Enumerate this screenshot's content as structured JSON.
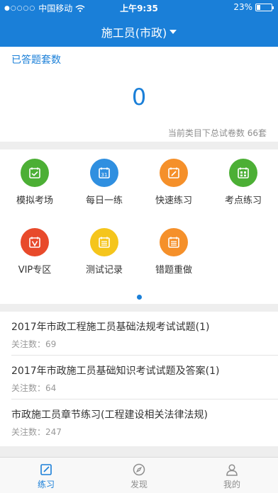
{
  "status_bar": {
    "carrier": "中国移动",
    "time": "上午9:35",
    "battery": "23%",
    "battery_level": 0.23
  },
  "nav": {
    "title": "施工员(市政)"
  },
  "stats": {
    "label": "已答题套数",
    "count": "0",
    "note": "当前类目下总试卷数 66套"
  },
  "grid": [
    {
      "label": "模拟考场",
      "color": "#4caf35",
      "icon": "exam-icon"
    },
    {
      "label": "每日一练",
      "color": "#2f8fe0",
      "icon": "calendar-icon"
    },
    {
      "label": "快速练习",
      "color": "#f5902a",
      "icon": "pencil-icon"
    },
    {
      "label": "考点练习",
      "color": "#4caf35",
      "icon": "grid-icon"
    },
    {
      "label": "VIP专区",
      "color": "#e84a2b",
      "icon": "vip-icon"
    },
    {
      "label": "测试记录",
      "color": "#f5c51c",
      "icon": "list-icon"
    },
    {
      "label": "错题重做",
      "color": "#f5902a",
      "icon": "list-icon"
    }
  ],
  "list": [
    {
      "title": "2017年市政工程施工员基础法规考试试题(1)",
      "meta": "关注数：69"
    },
    {
      "title": "2017年市政施工员基础知识考试试题及答案(1)",
      "meta": "关注数：64"
    },
    {
      "title": "市政施工员章节练习(工程建设相关法律法规)",
      "meta": "关注数：247"
    }
  ],
  "tabs": [
    {
      "label": "练习",
      "icon": "edit-icon",
      "active": true
    },
    {
      "label": "发现",
      "icon": "compass-icon",
      "active": false
    },
    {
      "label": "我的",
      "icon": "user-icon",
      "active": false
    }
  ],
  "colors": {
    "brand": "#1a7fd8"
  }
}
